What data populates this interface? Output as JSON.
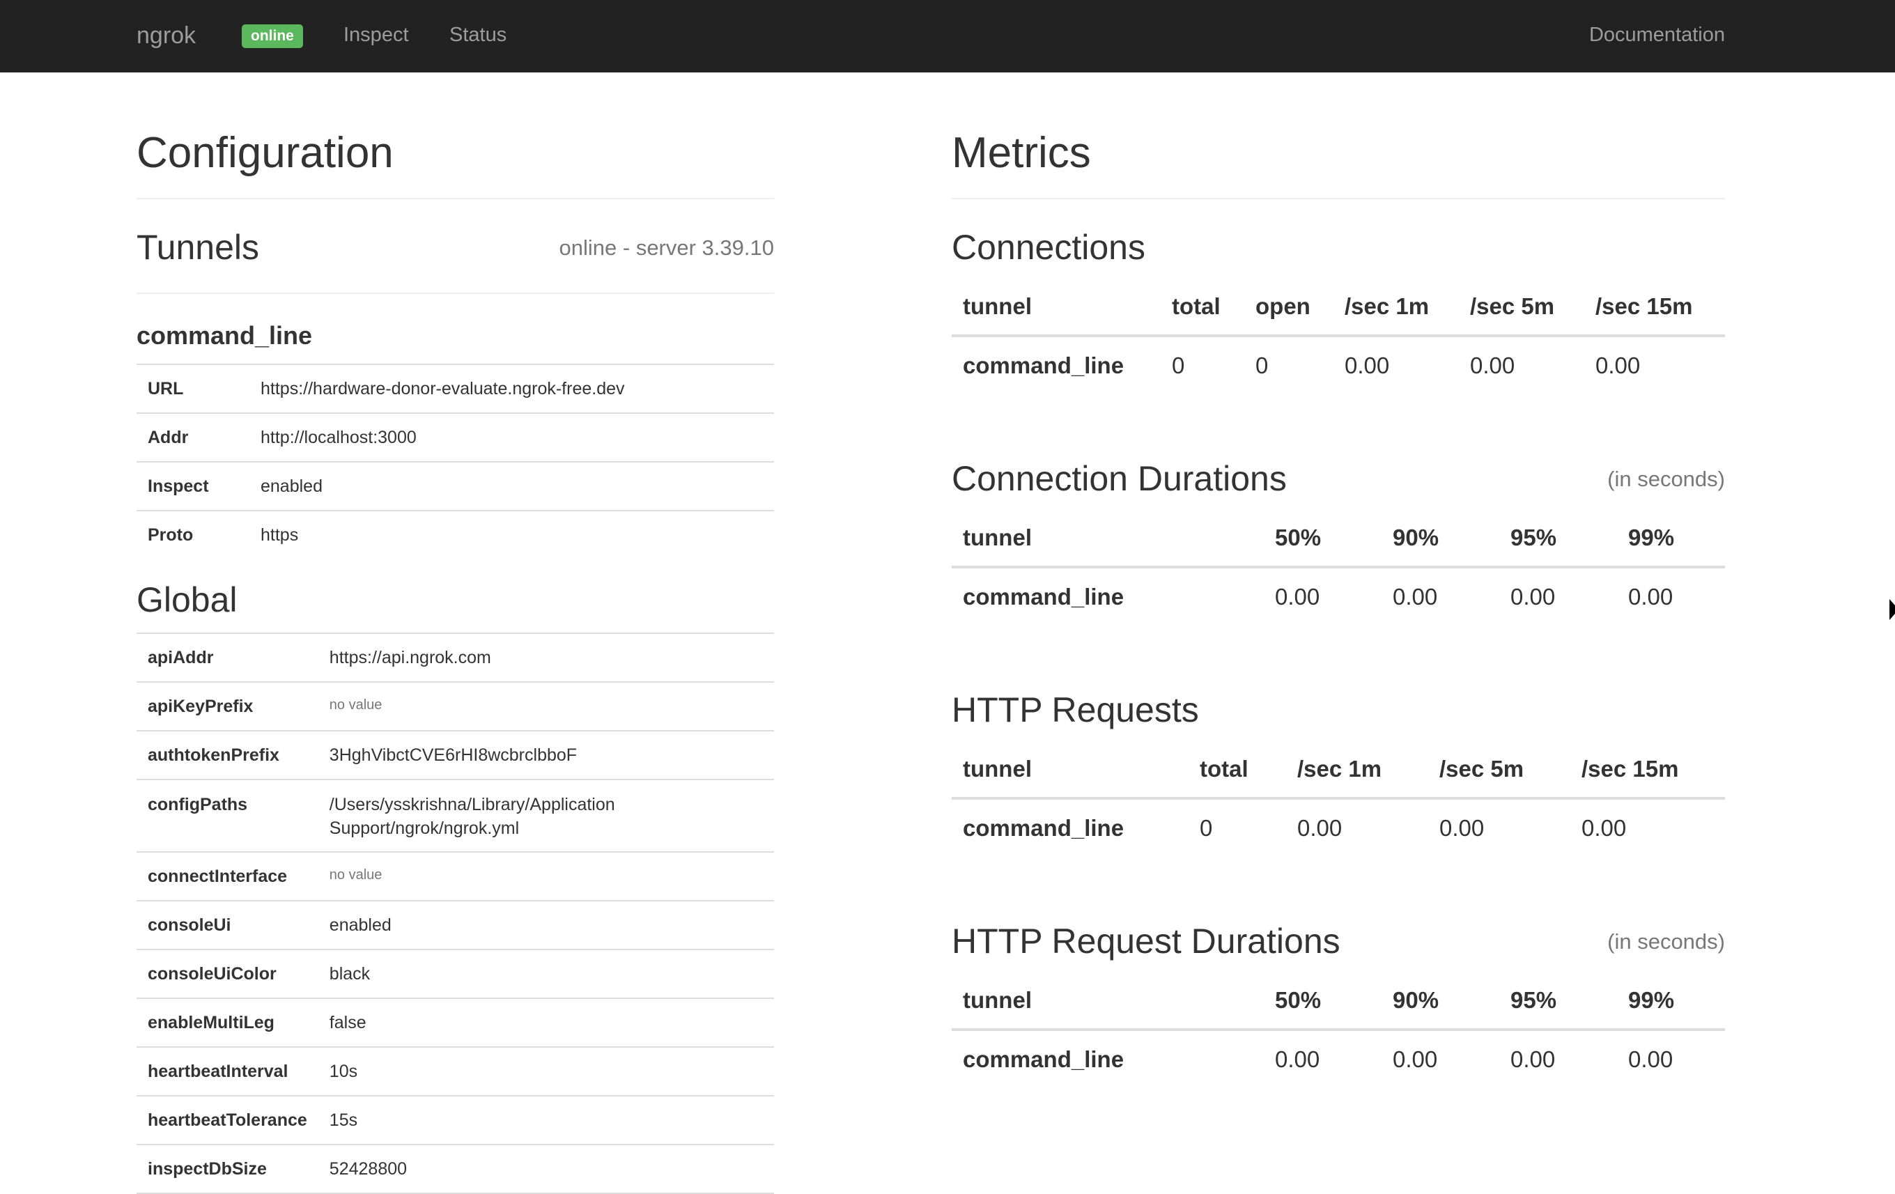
{
  "nav": {
    "brand": "ngrok",
    "badge": "online",
    "links": [
      "Inspect",
      "Status"
    ],
    "documentation": "Documentation"
  },
  "configuration": {
    "title": "Configuration",
    "tunnels_title": "Tunnels",
    "tunnels_status": "online - server 3.39.10",
    "tunnel_name": "command_line",
    "tunnel_rows": [
      {
        "key": "URL",
        "value": "https://hardware-donor-evaluate.ngrok-free.dev"
      },
      {
        "key": "Addr",
        "value": "http://localhost:3000"
      },
      {
        "key": "Inspect",
        "value": "enabled"
      },
      {
        "key": "Proto",
        "value": "https"
      }
    ],
    "global_title": "Global",
    "global_rows": [
      {
        "key": "apiAddr",
        "value": "https://api.ngrok.com"
      },
      {
        "key": "apiKeyPrefix",
        "value": "no value",
        "novalue": true
      },
      {
        "key": "authtokenPrefix",
        "value": "3HghVibctCVE6rHI8wcbrclbboF"
      },
      {
        "key": "configPaths",
        "value": "/Users/ysskrishna/Library/Application",
        "value2": "Support/ngrok/ngrok.yml"
      },
      {
        "key": "connectInterface",
        "value": "no value",
        "novalue": true
      },
      {
        "key": "consoleUi",
        "value": "enabled"
      },
      {
        "key": "consoleUiColor",
        "value": "black"
      },
      {
        "key": "enableMultiLeg",
        "value": "false"
      },
      {
        "key": "heartbeatInterval",
        "value": "10s"
      },
      {
        "key": "heartbeatTolerance",
        "value": "15s"
      },
      {
        "key": "inspectDbSize",
        "value": "52428800"
      }
    ]
  },
  "metrics": {
    "title": "Metrics",
    "connections": {
      "title": "Connections",
      "headers": [
        "tunnel",
        "total",
        "open",
        "/sec 1m",
        "/sec 5m",
        "/sec 15m"
      ],
      "row": [
        "command_line",
        "0",
        "0",
        "0.00",
        "0.00",
        "0.00"
      ]
    },
    "connection_durations": {
      "title": "Connection Durations",
      "note": "(in seconds)",
      "headers": [
        "tunnel",
        "50%",
        "90%",
        "95%",
        "99%"
      ],
      "row": [
        "command_line",
        "0.00",
        "0.00",
        "0.00",
        "0.00"
      ]
    },
    "http_requests": {
      "title": "HTTP Requests",
      "headers": [
        "tunnel",
        "total",
        "/sec 1m",
        "/sec 5m",
        "/sec 15m"
      ],
      "row": [
        "command_line",
        "0",
        "0.00",
        "0.00",
        "0.00"
      ]
    },
    "http_request_durations": {
      "title": "HTTP Request Durations",
      "note": "(in seconds)",
      "headers": [
        "tunnel",
        "50%",
        "90%",
        "95%",
        "99%"
      ],
      "row": [
        "command_line",
        "0.00",
        "0.00",
        "0.00",
        "0.00"
      ]
    }
  }
}
